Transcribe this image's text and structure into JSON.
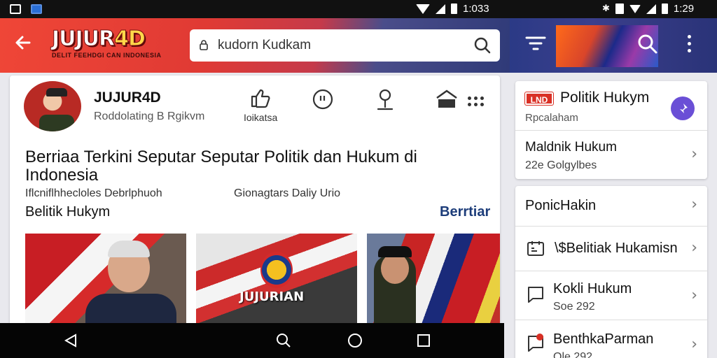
{
  "status_bar": {
    "time_left": "1:033",
    "time_right": "1:29"
  },
  "app_bar": {
    "logo": "JUJUR4D",
    "logo_tagline": "DELIT FEEHDGI CAN INDONESIA",
    "search_value": "kudorn Kudkam"
  },
  "channel": {
    "name": "JUJUR4D",
    "subtitle": "Roddolating B Rgikvm",
    "actions": [
      {
        "label": "Ioikatsa",
        "icon": "like-icon"
      },
      {
        "label": "",
        "icon": "comment-icon"
      },
      {
        "label": "",
        "icon": "microphone-icon"
      },
      {
        "label": "",
        "icon": "share-icon"
      }
    ]
  },
  "article": {
    "headline": "Berriaa Terkini Seputar Seputar Politik dan Hukum di Indonesia",
    "meta_left": "Iflcniflhhecloles Debrlphuoh",
    "meta_right": "Gionagtars Daliy Urio",
    "section": "Belitik Hukym",
    "section_link": "Berrtiar",
    "thumb_caption": "JUJURIAN"
  },
  "sidebar_top": {
    "badge": "LND",
    "title": "Politik Hukym",
    "subtitle": "Rpcalaham",
    "item_title": "Maldnik Hukum",
    "item_sub": "22e Golgylbes"
  },
  "sidebar_list": [
    {
      "label": "PonicHakin",
      "sub": "",
      "icon": ""
    },
    {
      "label": "\\$Belitiak Hukamisn",
      "sub": "",
      "icon": "calendar-icon"
    },
    {
      "label": "Kokli Hukum",
      "sub": "Soe 292",
      "icon": "chat-icon"
    },
    {
      "label": "BenthkaParman",
      "sub": "Ole 292",
      "icon": "notification-icon"
    }
  ],
  "colors": {
    "appbar_red": "#ef4637",
    "appbar_navy": "#2f3a78",
    "link_blue": "#1d3d7a",
    "badge_red": "#d93025",
    "fab_purple": "#6a4fd6"
  }
}
